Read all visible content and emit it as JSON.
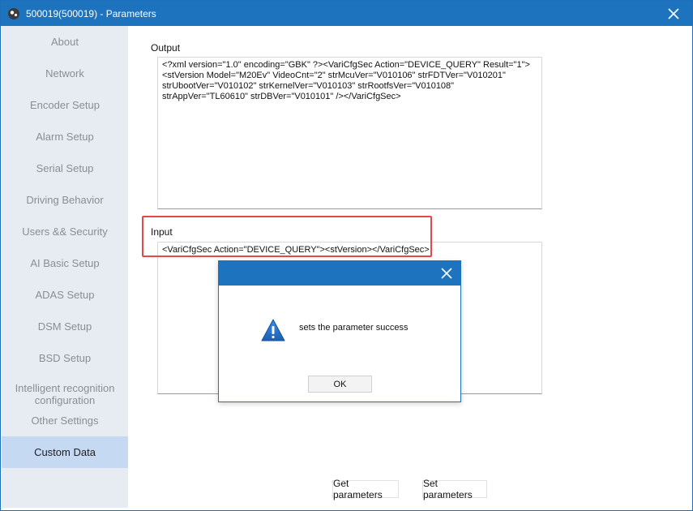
{
  "window": {
    "title": "500019(500019) - Parameters"
  },
  "sidebar": {
    "items": [
      {
        "label": "About"
      },
      {
        "label": "Network"
      },
      {
        "label": "Encoder Setup"
      },
      {
        "label": "Alarm Setup"
      },
      {
        "label": "Serial Setup"
      },
      {
        "label": "Driving Behavior"
      },
      {
        "label": "Users && Security"
      },
      {
        "label": "AI Basic Setup"
      },
      {
        "label": "ADAS Setup"
      },
      {
        "label": "DSM Setup"
      },
      {
        "label": "BSD Setup"
      },
      {
        "label": "Intelligent recognition configuration"
      },
      {
        "label": "Other Settings"
      },
      {
        "label": "Custom Data",
        "active": true
      }
    ]
  },
  "output": {
    "label": "Output",
    "lines": [
      "<?xml version=\"1.0\" encoding=\"GBK\" ?><VariCfgSec Action=\"DEVICE_QUERY\" Result=\"1\">",
      "<stVersion Model=\"M20Ev\" VideoCnt=\"2\" strMcuVer=\"V010106\" strFDTVer=\"V010201\"",
      "strUbootVer=\"V010102\" strKernelVer=\"V010103\" strRootfsVer=\"V010108\"",
      "strAppVer=\"TL60610\" strDBVer=\"V010101\" /></VariCfgSec>"
    ]
  },
  "input": {
    "label": "Input",
    "value": "<VariCfgSec Action=\"DEVICE_QUERY\"><stVersion></VariCfgSec>"
  },
  "buttons": {
    "get": "Get parameters",
    "set": "Set parameters"
  },
  "dialog": {
    "message": "sets the parameter success",
    "ok": "OK",
    "icon": "warning-icon"
  },
  "colors": {
    "titlebar": "#1e73be",
    "sidebar_bg": "#e7ecf3",
    "sidebar_active": "#c5d9f2",
    "highlight": "#e5474a"
  }
}
